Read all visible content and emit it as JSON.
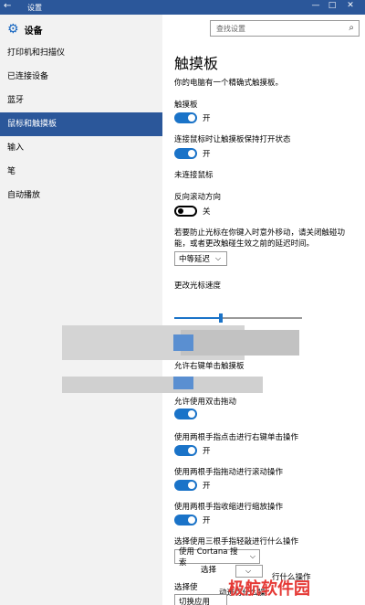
{
  "window": {
    "back_icon": "back-arrow-icon",
    "title": "设置",
    "controls": [
      "—",
      "□",
      "✕"
    ]
  },
  "sidebar": {
    "header": "设备",
    "items": [
      {
        "label": "打印机和扫描仪",
        "active": false
      },
      {
        "label": "已连接设备",
        "active": false
      },
      {
        "label": "蓝牙",
        "active": false
      },
      {
        "label": "鼠标和触摸板",
        "active": true
      },
      {
        "label": "输入",
        "active": false
      },
      {
        "label": "笔",
        "active": false
      },
      {
        "label": "自动播放",
        "active": false
      }
    ]
  },
  "search": {
    "placeholder": "查找设置"
  },
  "main": {
    "title": "触摸板",
    "subtitle": "你的电脑有一个精确式触摸板。",
    "touchpad_label": "触摸板",
    "touchpad_state": "开",
    "keep_on_label": "连接鼠标时让触摸板保持打开状态",
    "keep_on_state": "开",
    "no_mouse": "未连接鼠标",
    "reverse_label": "反向滚动方向",
    "reverse_state": "关",
    "delay_text_1": "若要防止光标在你键入时意外移动，请关闭触碰功",
    "delay_text_2": "能，或者更改触碰生效之前的延迟时间。",
    "delay_value": "中等延迟",
    "cursor_speed_label": "更改光标速度",
    "cursor_speed_fraction": 0.35,
    "right_click_label": "允许右键单击触摸板",
    "double_tap_label": "允许使用双击拖动",
    "two_finger_right_label": "使用两根手指点击进行右键单击操作",
    "two_finger_right_state": "开",
    "two_finger_scroll_label": "使用两根手指拖动进行滚动操作",
    "two_finger_scroll_state": "开",
    "pinch_label": "使用两根手指收缩进行缩放操作",
    "pinch_state": "开",
    "three_finger_label": "选择使用三根手指轻敲进行什么操作",
    "three_finger_value": "使用 Cortana 搜索",
    "three_finger_swipe_label": "选择",
    "three_finger_swipe_tail": "行什么操作",
    "three_finger_swipe_label_2": "选择使",
    "three_finger_swipe_tail_2": "动进行什么操",
    "switch_apps_value": "切换应用",
    "watermark": "极航软件园"
  }
}
